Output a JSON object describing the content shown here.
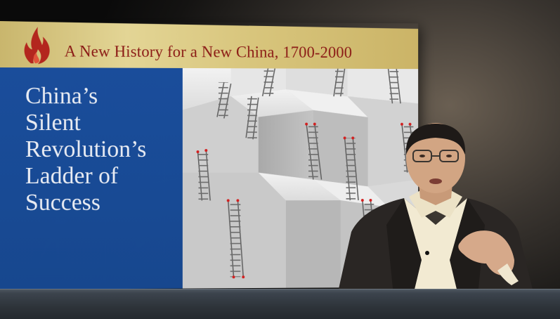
{
  "slide": {
    "banner_title": "A New History for a New China, 1700-2000",
    "heading_lines": [
      "China’s",
      "Silent",
      "Revolution’s",
      "Ladder of",
      "Success"
    ],
    "image_subject": "gray cubes with ladders",
    "logo_icon": "flame-icon"
  },
  "colors": {
    "banner": "#d8c57c",
    "banner_text": "#8b1a15",
    "panel_blue": "#1a4d9b",
    "heading_text": "#e9ecf3",
    "bottom_bar": "#2d3339"
  }
}
